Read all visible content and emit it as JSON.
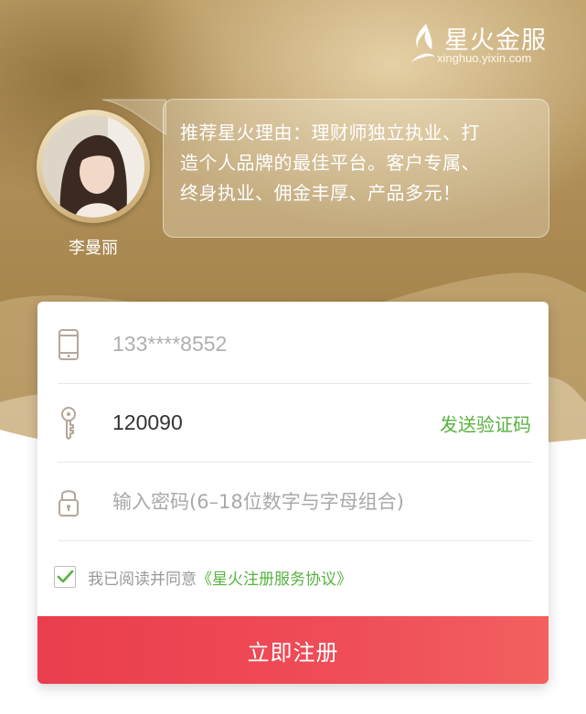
{
  "brand": {
    "name": "星火金服",
    "url": "xinghuo.yixin.com"
  },
  "advisor": {
    "name": "李曼丽",
    "message_lines": [
      "推荐星火理由：理财师独立执业、打",
      "造个人品牌的最佳平台。客户专属、",
      "终身执业、佣金丰厚、产品多元！"
    ]
  },
  "form": {
    "phone": {
      "placeholder": "133****8552",
      "icon": "phone-icon"
    },
    "code": {
      "value": "120090",
      "icon": "key-icon",
      "send_label": "发送验证码"
    },
    "password": {
      "placeholder": "输入密码(6–18位数字与字母组合)",
      "icon": "lock-icon"
    },
    "agreement": {
      "checked": true,
      "text": "我已阅读并同意",
      "link": "《星火注册服务协议》"
    },
    "submit_label": "立即注册"
  },
  "colors": {
    "accent_green": "#57b23f",
    "submit_red": "#ea3e4d",
    "background_gold": "#a8874f"
  }
}
